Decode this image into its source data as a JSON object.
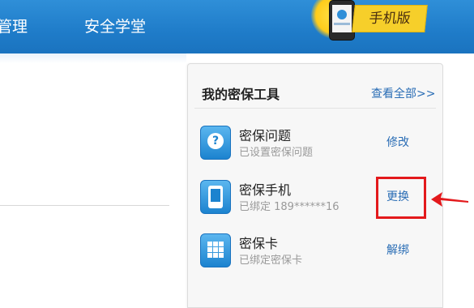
{
  "nav": {
    "items": [
      {
        "label": "管理"
      },
      {
        "label": "安全学堂"
      }
    ]
  },
  "badge": {
    "label": "手机版",
    "icon": "mobile-phone-icon"
  },
  "panel": {
    "title": "我的密保工具",
    "view_all": "查看全部>>",
    "tools": [
      {
        "name": "密保问题",
        "status": "已设置密保问题",
        "action": "修改",
        "icon": "question-icon"
      },
      {
        "name": "密保手机",
        "status": "已绑定 189******16",
        "action": "更换",
        "icon": "phone-icon"
      },
      {
        "name": "密保卡",
        "status": "已绑定密保卡",
        "action": "解绑",
        "icon": "grid-card-icon"
      }
    ]
  },
  "colors": {
    "nav_bg": "#1f7cc9",
    "link": "#2a6db5",
    "highlight": "#e3191c",
    "badge_yellow": "#f6cf2a"
  }
}
